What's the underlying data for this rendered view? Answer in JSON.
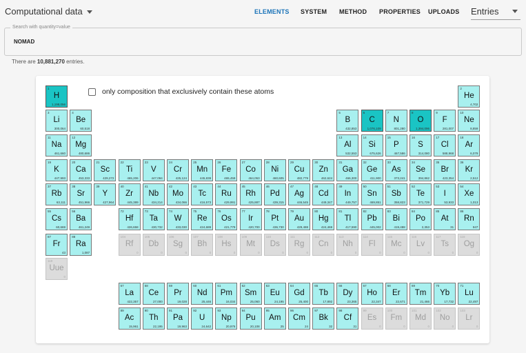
{
  "header": {
    "app_select": "Computational data",
    "tabs": [
      "ELEMENTS",
      "SYSTEM",
      "METHOD",
      "PROPERTIES",
      "UPLOADS"
    ],
    "active_tab": "ELEMENTS",
    "entries_select": "Entries"
  },
  "search": {
    "legend": "Search with quantity=value",
    "value": "NOMAD"
  },
  "entries": {
    "prefix": "There are ",
    "count": "10,881,270",
    "suffix": " entries."
  },
  "exclusive_label": "only composition that exclusively contain these atoms",
  "colors": {
    "available": "#a8f0ef",
    "selected": "#1ac4c4",
    "disabled": "#dcdcdc",
    "accent": "#1a73b8"
  },
  "elements": [
    {
      "n": 1,
      "s": "H",
      "c": "1,198,056",
      "p": 1,
      "g": 1,
      "hi": true
    },
    {
      "n": 2,
      "s": "He",
      "c": "4,702",
      "p": 1,
      "g": 18
    },
    {
      "n": 3,
      "s": "Li",
      "c": "300,064",
      "p": 2,
      "g": 1
    },
    {
      "n": 4,
      "s": "Be",
      "c": "60,518",
      "p": 2,
      "g": 2
    },
    {
      "n": 5,
      "s": "B",
      "c": "432,853",
      "p": 2,
      "g": 13
    },
    {
      "n": 6,
      "s": "C",
      "c": "1,076,109",
      "p": 2,
      "g": 14,
      "hi": true
    },
    {
      "n": 7,
      "s": "N",
      "c": "801,280",
      "p": 2,
      "g": 15
    },
    {
      "n": 8,
      "s": "O",
      "c": "1,394,096",
      "p": 2,
      "g": 16,
      "hi": true
    },
    {
      "n": 9,
      "s": "F",
      "c": "281,007",
      "p": 2,
      "g": 17
    },
    {
      "n": 10,
      "s": "Ne",
      "c": "8,859",
      "p": 2,
      "g": 18
    },
    {
      "n": 11,
      "s": "Na",
      "c": "461,660",
      "p": 3,
      "g": 1
    },
    {
      "n": 12,
      "s": "Mg",
      "c": "480,686",
      "p": 3,
      "g": 2
    },
    {
      "n": 13,
      "s": "Al",
      "c": "532,553",
      "p": 3,
      "g": 13
    },
    {
      "n": 14,
      "s": "Si",
      "c": "675,626",
      "p": 3,
      "g": 14
    },
    {
      "n": 15,
      "s": "P",
      "c": "467,586",
      "p": 3,
      "g": 15
    },
    {
      "n": 16,
      "s": "S",
      "c": "314,080",
      "p": 3,
      "g": 16
    },
    {
      "n": 17,
      "s": "Cl",
      "c": "588,968",
      "p": 3,
      "g": 17
    },
    {
      "n": 18,
      "s": "Ar",
      "c": "6,079",
      "p": 3,
      "g": 18
    },
    {
      "n": 19,
      "s": "K",
      "c": "447,993",
      "p": 4,
      "g": 1
    },
    {
      "n": 20,
      "s": "Ca",
      "c": "453,333",
      "p": 4,
      "g": 2
    },
    {
      "n": 21,
      "s": "Sc",
      "c": "429,272",
      "p": 4,
      "g": 3
    },
    {
      "n": 22,
      "s": "Ti",
      "c": "465,206",
      "p": 4,
      "g": 4
    },
    {
      "n": 23,
      "s": "V",
      "c": "447,094",
      "p": 4,
      "g": 5
    },
    {
      "n": 24,
      "s": "Cr",
      "c": "425,124",
      "p": 4,
      "g": 6
    },
    {
      "n": 25,
      "s": "Mn",
      "c": "445,839",
      "p": 4,
      "g": 7
    },
    {
      "n": 26,
      "s": "Fe",
      "c": "465,459",
      "p": 4,
      "g": 8
    },
    {
      "n": 27,
      "s": "Co",
      "c": "464,053",
      "p": 4,
      "g": 9
    },
    {
      "n": 28,
      "s": "Ni",
      "c": "460,605",
      "p": 4,
      "g": 10
    },
    {
      "n": 29,
      "s": "Cu",
      "c": "482,779",
      "p": 4,
      "g": 11
    },
    {
      "n": 30,
      "s": "Zn",
      "c": "462,624",
      "p": 4,
      "g": 12
    },
    {
      "n": 31,
      "s": "Ga",
      "c": "466,300",
      "p": 4,
      "g": 13
    },
    {
      "n": 32,
      "s": "Ge",
      "c": "411,900",
      "p": 4,
      "g": 14
    },
    {
      "n": 33,
      "s": "As",
      "c": "373,241",
      "p": 4,
      "g": 15
    },
    {
      "n": 34,
      "s": "Se",
      "c": "394,862",
      "p": 4,
      "g": 16
    },
    {
      "n": 35,
      "s": "Br",
      "c": "423,354",
      "p": 4,
      "g": 17
    },
    {
      "n": 36,
      "s": "Kr",
      "c": "2,512",
      "p": 4,
      "g": 18
    },
    {
      "n": 37,
      "s": "Rb",
      "c": "63,111",
      "p": 5,
      "g": 1
    },
    {
      "n": 38,
      "s": "Sr",
      "c": "451,966",
      "p": 5,
      "g": 2
    },
    {
      "n": 39,
      "s": "Y",
      "c": "427,964",
      "p": 5,
      "g": 3
    },
    {
      "n": 40,
      "s": "Zr",
      "c": "445,389",
      "p": 5,
      "g": 4
    },
    {
      "n": 41,
      "s": "Nb",
      "c": "434,214",
      "p": 5,
      "g": 5
    },
    {
      "n": 42,
      "s": "Mo",
      "c": "434,066",
      "p": 5,
      "g": 6
    },
    {
      "n": 43,
      "s": "Tc",
      "c": "416,573",
      "p": 5,
      "g": 7
    },
    {
      "n": 44,
      "s": "Ru",
      "c": "429,991",
      "p": 5,
      "g": 8
    },
    {
      "n": 45,
      "s": "Rh",
      "c": "425,887",
      "p": 5,
      "g": 9
    },
    {
      "n": 46,
      "s": "Pd",
      "c": "439,315",
      "p": 5,
      "g": 10
    },
    {
      "n": 47,
      "s": "Ag",
      "c": "446,545",
      "p": 5,
      "g": 11
    },
    {
      "n": 48,
      "s": "Cd",
      "c": "449,347",
      "p": 5,
      "g": 12
    },
    {
      "n": 49,
      "s": "In",
      "c": "449,757",
      "p": 5,
      "g": 13
    },
    {
      "n": 50,
      "s": "Sn",
      "c": "469,851",
      "p": 5,
      "g": 14
    },
    {
      "n": 51,
      "s": "Sb",
      "c": "358,823",
      "p": 5,
      "g": 15
    },
    {
      "n": 52,
      "s": "Te",
      "c": "371,729",
      "p": 5,
      "g": 16
    },
    {
      "n": 53,
      "s": "I",
      "c": "53,933",
      "p": 5,
      "g": 17
    },
    {
      "n": 54,
      "s": "Xe",
      "c": "1,013",
      "p": 5,
      "g": 18
    },
    {
      "n": 55,
      "s": "Cs",
      "c": "60,669",
      "p": 6,
      "g": 1
    },
    {
      "n": 56,
      "s": "Ba",
      "c": "461,249",
      "p": 6,
      "g": 2
    },
    {
      "n": 72,
      "s": "Hf",
      "c": "426,658",
      "p": 6,
      "g": 4
    },
    {
      "n": 73,
      "s": "Ta",
      "c": "430,732",
      "p": 6,
      "g": 5
    },
    {
      "n": 74,
      "s": "W",
      "c": "433,030",
      "p": 6,
      "g": 6
    },
    {
      "n": 75,
      "s": "Re",
      "c": "424,689",
      "p": 6,
      "g": 7
    },
    {
      "n": 76,
      "s": "Os",
      "c": "421,779",
      "p": 6,
      "g": 8
    },
    {
      "n": 77,
      "s": "Ir",
      "c": "420,700",
      "p": 6,
      "g": 9
    },
    {
      "n": 78,
      "s": "Pt",
      "c": "436,730",
      "p": 6,
      "g": 10
    },
    {
      "n": 79,
      "s": "Au",
      "c": "429,488",
      "p": 6,
      "g": 11
    },
    {
      "n": 80,
      "s": "Hg",
      "c": "424,469",
      "p": 6,
      "g": 12
    },
    {
      "n": 81,
      "s": "Tl",
      "c": "417,590",
      "p": 6,
      "g": 13
    },
    {
      "n": 82,
      "s": "Pb",
      "c": "445,002",
      "p": 6,
      "g": 14
    },
    {
      "n": 83,
      "s": "Bi",
      "c": "419,488",
      "p": 6,
      "g": 15
    },
    {
      "n": 84,
      "s": "Po",
      "c": "2,353",
      "p": 6,
      "g": 16
    },
    {
      "n": 85,
      "s": "At",
      "c": "31",
      "p": 6,
      "g": 17
    },
    {
      "n": 86,
      "s": "Rn",
      "c": "947",
      "p": 6,
      "g": 18
    },
    {
      "n": 87,
      "s": "Fr",
      "c": "43",
      "p": 7,
      "g": 1
    },
    {
      "n": 88,
      "s": "Ra",
      "c": "1,087",
      "p": 7,
      "g": 2
    },
    {
      "n": 104,
      "s": "Rf",
      "c": "0",
      "p": 7,
      "g": 4,
      "dis": true
    },
    {
      "n": 105,
      "s": "Db",
      "c": "0",
      "p": 7,
      "g": 5,
      "dis": true
    },
    {
      "n": 106,
      "s": "Sg",
      "c": "0",
      "p": 7,
      "g": 6,
      "dis": true
    },
    {
      "n": 107,
      "s": "Bh",
      "c": "0",
      "p": 7,
      "g": 7,
      "dis": true
    },
    {
      "n": 108,
      "s": "Hs",
      "c": "0",
      "p": 7,
      "g": 8,
      "dis": true
    },
    {
      "n": 109,
      "s": "Mt",
      "c": "0",
      "p": 7,
      "g": 9,
      "dis": true
    },
    {
      "n": 110,
      "s": "Ds",
      "c": "0",
      "p": 7,
      "g": 10,
      "dis": true
    },
    {
      "n": 111,
      "s": "Rg",
      "c": "0",
      "p": 7,
      "g": 11,
      "dis": true
    },
    {
      "n": 112,
      "s": "Cn",
      "c": "0",
      "p": 7,
      "g": 12,
      "dis": true
    },
    {
      "n": 113,
      "s": "Nh",
      "c": "0",
      "p": 7,
      "g": 13,
      "dis": true
    },
    {
      "n": 114,
      "s": "Fl",
      "c": "0",
      "p": 7,
      "g": 14,
      "dis": true
    },
    {
      "n": 115,
      "s": "Mc",
      "c": "0",
      "p": 7,
      "g": 15,
      "dis": true
    },
    {
      "n": 116,
      "s": "Lv",
      "c": "0",
      "p": 7,
      "g": 16,
      "dis": true
    },
    {
      "n": 117,
      "s": "Ts",
      "c": "0",
      "p": 7,
      "g": 17,
      "dis": true
    },
    {
      "n": 118,
      "s": "Og",
      "c": "0",
      "p": 7,
      "g": 18,
      "dis": true
    },
    {
      "n": 119,
      "s": "Uue",
      "c": "0",
      "p": 8,
      "g": 1,
      "dis": true
    },
    {
      "n": 57,
      "s": "La",
      "c": "422,357",
      "p": 9,
      "g": 4
    },
    {
      "n": 58,
      "s": "Ce",
      "c": "27,000",
      "p": 9,
      "g": 5
    },
    {
      "n": 59,
      "s": "Pr",
      "c": "19,028",
      "p": 9,
      "g": 6
    },
    {
      "n": 60,
      "s": "Nd",
      "c": "25,446",
      "p": 9,
      "g": 7
    },
    {
      "n": 61,
      "s": "Pm",
      "c": "16,034",
      "p": 9,
      "g": 8
    },
    {
      "n": 62,
      "s": "Sm",
      "c": "25,060",
      "p": 9,
      "g": 9
    },
    {
      "n": 63,
      "s": "Eu",
      "c": "24,195",
      "p": 9,
      "g": 10
    },
    {
      "n": 64,
      "s": "Gd",
      "c": "25,400",
      "p": 9,
      "g": 11
    },
    {
      "n": 65,
      "s": "Tb",
      "c": "17,892",
      "p": 9,
      "g": 12
    },
    {
      "n": 66,
      "s": "Dy",
      "c": "23,365",
      "p": 9,
      "g": 13
    },
    {
      "n": 67,
      "s": "Ho",
      "c": "22,347",
      "p": 9,
      "g": 14
    },
    {
      "n": 68,
      "s": "Er",
      "c": "22,671",
      "p": 9,
      "g": 15
    },
    {
      "n": 69,
      "s": "Tm",
      "c": "21,466",
      "p": 9,
      "g": 16
    },
    {
      "n": 70,
      "s": "Yb",
      "c": "17,732",
      "p": 9,
      "g": 17
    },
    {
      "n": 71,
      "s": "Lu",
      "c": "22,497",
      "p": 9,
      "g": 18
    },
    {
      "n": 89,
      "s": "Ac",
      "c": "15,961",
      "p": 10,
      "g": 4
    },
    {
      "n": 90,
      "s": "Th",
      "c": "22,195",
      "p": 10,
      "g": 5
    },
    {
      "n": 91,
      "s": "Pa",
      "c": "19,963",
      "p": 10,
      "g": 6
    },
    {
      "n": 92,
      "s": "U",
      "c": "24,642",
      "p": 10,
      "g": 7
    },
    {
      "n": 93,
      "s": "Np",
      "c": "20,976",
      "p": 10,
      "g": 8
    },
    {
      "n": 94,
      "s": "Pu",
      "c": "20,108",
      "p": 10,
      "g": 9
    },
    {
      "n": 95,
      "s": "Am",
      "c": "25",
      "p": 10,
      "g": 10
    },
    {
      "n": 96,
      "s": "Cm",
      "c": "24",
      "p": 10,
      "g": 11
    },
    {
      "n": 97,
      "s": "Bk",
      "c": "32",
      "p": 10,
      "g": 12
    },
    {
      "n": 98,
      "s": "Cf",
      "c": "31",
      "p": 10,
      "g": 13
    },
    {
      "n": 99,
      "s": "Es",
      "c": "0",
      "p": 10,
      "g": 14,
      "dis": true
    },
    {
      "n": 100,
      "s": "Fm",
      "c": "0",
      "p": 10,
      "g": 15,
      "dis": true
    },
    {
      "n": 101,
      "s": "Md",
      "c": "0",
      "p": 10,
      "g": 16,
      "dis": true
    },
    {
      "n": 102,
      "s": "No",
      "c": "0",
      "p": 10,
      "g": 17,
      "dis": true
    },
    {
      "n": 103,
      "s": "Lr",
      "c": "0",
      "p": 10,
      "g": 18,
      "dis": true
    }
  ]
}
